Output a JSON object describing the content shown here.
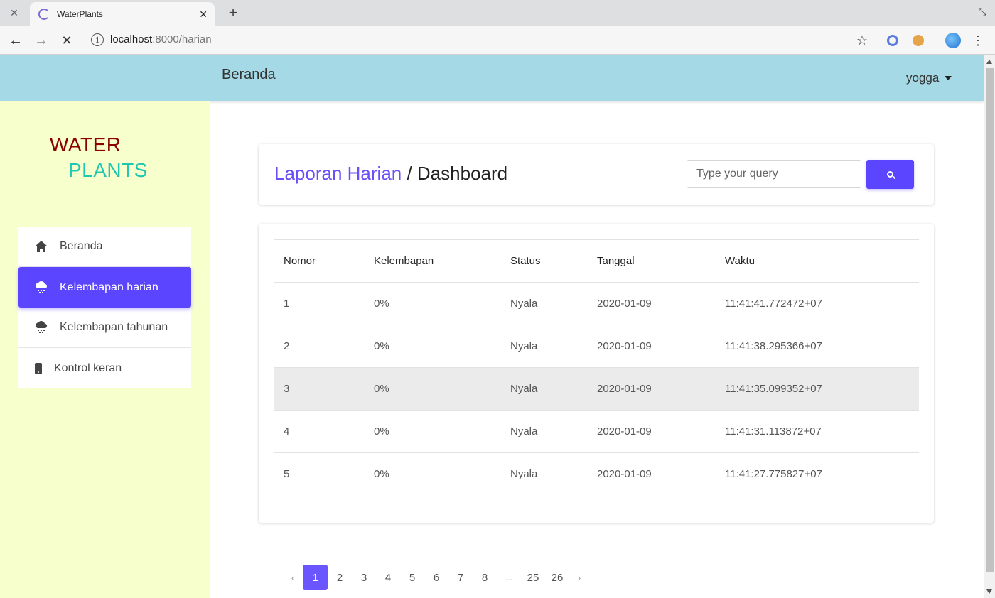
{
  "browser": {
    "closed_tab_icon": "close-icon",
    "tab_title": "WaterPlants",
    "url_host": "localhost",
    "url_rest": ":8000/harian"
  },
  "header": {
    "title": "Beranda",
    "user": "yogga"
  },
  "sidebar": {
    "logo_line1": "WATER",
    "logo_line2": "PLANTS",
    "items": [
      {
        "label": "Beranda",
        "icon": "home-icon"
      },
      {
        "label": "Kelembapan harian",
        "icon": "cloud-rain-icon",
        "active": true
      },
      {
        "label": "Kelembapan tahunan",
        "icon": "cloud-rain-icon"
      },
      {
        "label": "Kontrol keran",
        "icon": "phone-icon"
      }
    ]
  },
  "page": {
    "title_link": "Laporan Harian",
    "title_sep": " / ",
    "title_current": "Dashboard",
    "search_placeholder": "Type your query"
  },
  "table": {
    "columns": [
      "Nomor",
      "Kelembapan",
      "Status",
      "Tanggal",
      "Waktu"
    ],
    "rows": [
      [
        "1",
        "0%",
        "Nyala",
        "2020-01-09",
        "11:41:41.772472+07"
      ],
      [
        "2",
        "0%",
        "Nyala",
        "2020-01-09",
        "11:41:38.295366+07"
      ],
      [
        "3",
        "0%",
        "Nyala",
        "2020-01-09",
        "11:41:35.099352+07"
      ],
      [
        "4",
        "0%",
        "Nyala",
        "2020-01-09",
        "11:41:31.113872+07"
      ],
      [
        "5",
        "0%",
        "Nyala",
        "2020-01-09",
        "11:41:27.775827+07"
      ]
    ]
  },
  "pagination": {
    "prev": "‹",
    "pages": [
      "1",
      "2",
      "3",
      "4",
      "5",
      "6",
      "7",
      "8",
      "...",
      "25",
      "26"
    ],
    "next": "›",
    "current": "1"
  },
  "colors": {
    "accent": "#5c45ff",
    "header_bg": "#a6d9e6",
    "sidebar_bg": "#f7ffcc",
    "logo_water": "#8b0000",
    "logo_plants": "#1fc6b0"
  }
}
